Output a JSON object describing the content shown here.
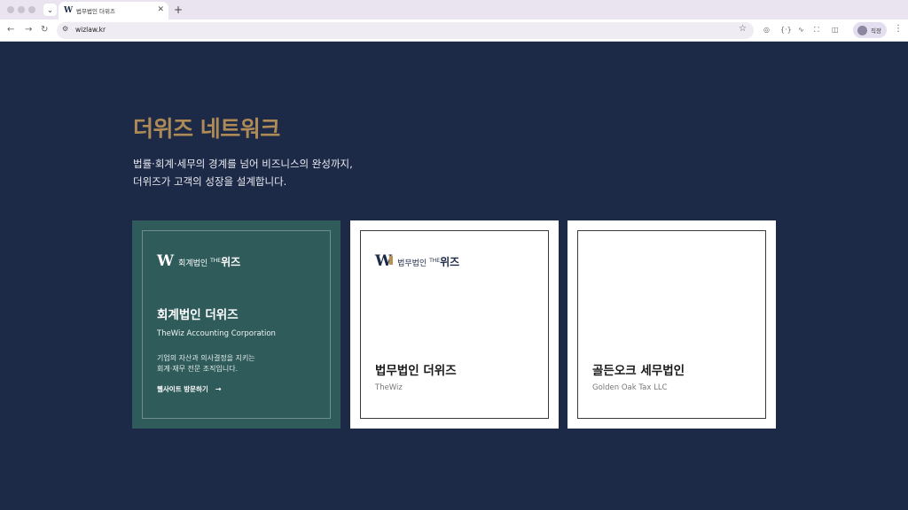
{
  "browser": {
    "tab_title": "법무법인 더위즈",
    "tab_favicon": "W",
    "url": "wizlaw.kr",
    "profile_label": "직장",
    "icons": [
      "back-icon",
      "forward-icon",
      "reload-icon",
      "site-settings-icon",
      "bookmark-star-icon",
      "extension-icons",
      "menu-icon"
    ]
  },
  "network": {
    "title": "더위즈 네트워크",
    "desc_line1": "법률·회계·세무의 경계를 넘어 비즈니스의 완성까지,",
    "desc_line2": "더위즈가 고객의 성장을 설계합니다."
  },
  "cards": [
    {
      "logo_mark": "W",
      "logo_small": "회계법인",
      "logo_the": "THE",
      "logo_big": "위즈",
      "name": "회계법인 더위즈",
      "sub": "TheWiz Accounting Corporation",
      "desc_line1": "기업의 자산과 의사결정을 지키는",
      "desc_line2": "회계·재무 전문 조직입니다.",
      "link": "웹사이트 방문하기",
      "link_arrow": "→"
    },
    {
      "logo_mark": "W",
      "logo_small": "법무법인",
      "logo_the": "THE",
      "logo_big": "위즈",
      "name": "법무법인 더위즈",
      "sub": "TheWiz"
    },
    {
      "name": "골든오크 세무법인",
      "sub": "Golden Oak Tax LLC"
    }
  ],
  "colors": {
    "background": "#1d2a47",
    "accent_gold": "#ad8a56",
    "active_card": "#2f5b5b"
  }
}
